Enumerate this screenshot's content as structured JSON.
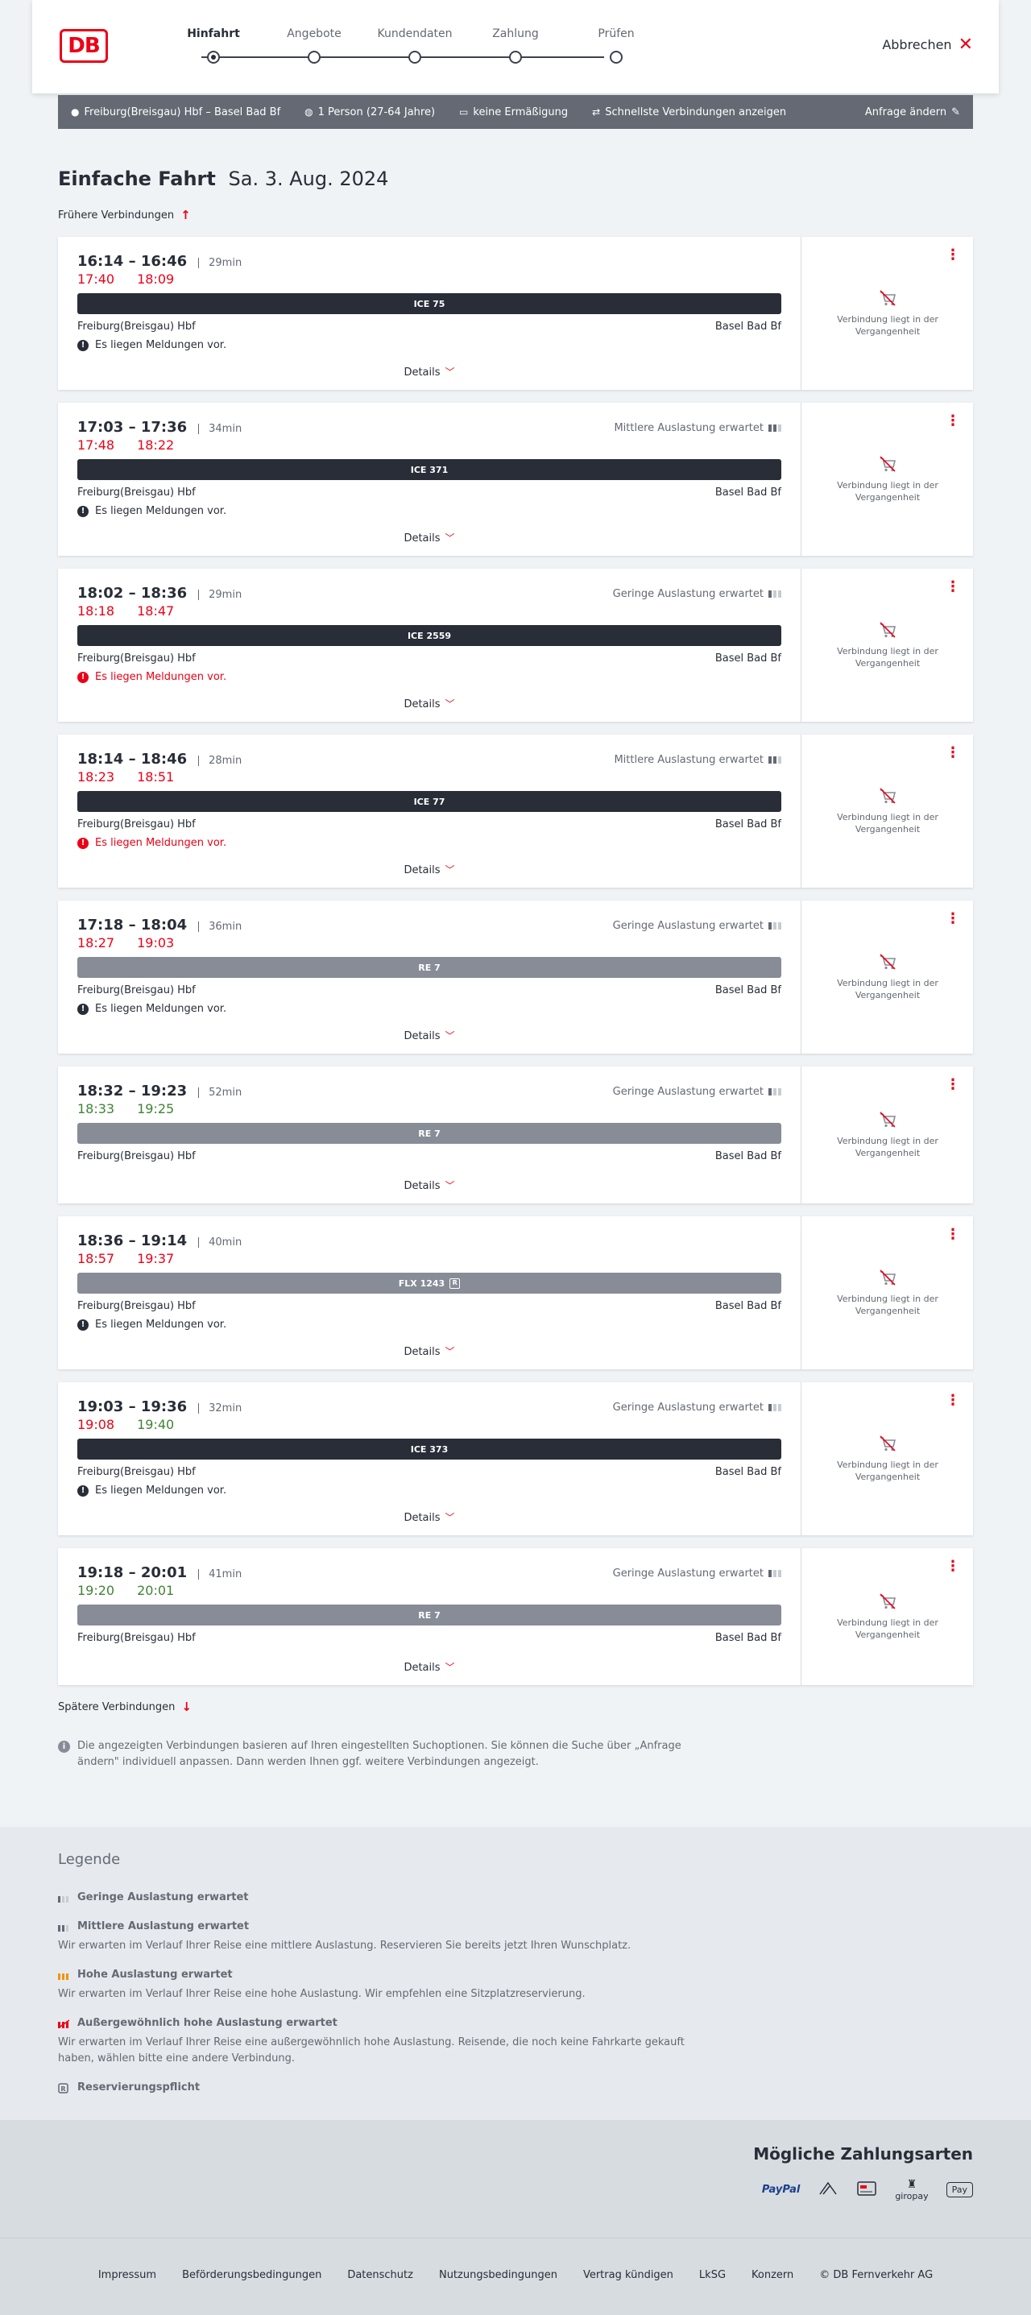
{
  "header": {
    "logo": "DB",
    "steps": [
      {
        "label": "Hinfahrt",
        "active": true
      },
      {
        "label": "Angebote",
        "active": false
      },
      {
        "label": "Kundendaten",
        "active": false
      },
      {
        "label": "Zahlung",
        "active": false
      },
      {
        "label": "Prüfen",
        "active": false
      }
    ],
    "cancel_label": "Abbrechen"
  },
  "query": {
    "route": "Freiburg(Breisgau) Hbf – Basel Bad Bf",
    "persons": "1 Person (27-64 Jahre)",
    "discount": "keine Ermäßigung",
    "option": "Schnellste Verbindungen anzeigen",
    "change_label": "Anfrage ändern"
  },
  "title": {
    "main": "Einfache Fahrt",
    "date": "Sa. 3. Aug. 2024"
  },
  "earlier_label": "Frühere Verbindungen",
  "later_label": "Spätere Verbindungen",
  "details_label": "Details",
  "past_text_1": "Verbindung liegt in der",
  "past_text_2": "Vergangenheit",
  "connections": [
    {
      "times": "16:14 – 16:46",
      "duration": "29min",
      "occupancy": "",
      "rt_dep": "17:40",
      "rt_dep_status": "late",
      "rt_arr": "18:09",
      "rt_arr_status": "late",
      "train": "ICE 75",
      "style": "dark",
      "from": "Freiburg(Breisgau) Hbf",
      "to": "Basel Bad Bf",
      "message": "Es liegen Meldungen vor.",
      "message_style": "normal"
    },
    {
      "times": "17:03 – 17:36",
      "duration": "34min",
      "occupancy": "Mittlere Auslastung erwartet",
      "rt_dep": "17:48",
      "rt_dep_status": "late",
      "rt_arr": "18:22",
      "rt_arr_status": "late",
      "train": "ICE 371",
      "style": "dark",
      "from": "Freiburg(Breisgau) Hbf",
      "to": "Basel Bad Bf",
      "message": "Es liegen Meldungen vor.",
      "message_style": "normal"
    },
    {
      "times": "18:02 – 18:36",
      "duration": "29min",
      "occupancy": "Geringe Auslastung erwartet",
      "rt_dep": "18:18",
      "rt_dep_status": "late",
      "rt_arr": "18:47",
      "rt_arr_status": "late",
      "train": "ICE 2559",
      "style": "dark",
      "from": "Freiburg(Breisgau) Hbf",
      "to": "Basel Bad Bf",
      "message": "Es liegen Meldungen vor.",
      "message_style": "red"
    },
    {
      "times": "18:14 – 18:46",
      "duration": "28min",
      "occupancy": "Mittlere Auslastung erwartet",
      "rt_dep": "18:23",
      "rt_dep_status": "late",
      "rt_arr": "18:51",
      "rt_arr_status": "late",
      "train": "ICE 77",
      "style": "dark",
      "from": "Freiburg(Breisgau) Hbf",
      "to": "Basel Bad Bf",
      "message": "Es liegen Meldungen vor.",
      "message_style": "red"
    },
    {
      "times": "17:18 – 18:04",
      "duration": "36min",
      "occupancy": "Geringe Auslastung erwartet",
      "rt_dep": "18:27",
      "rt_dep_status": "late",
      "rt_arr": "19:03",
      "rt_arr_status": "late",
      "train": "RE 7",
      "style": "grey",
      "from": "Freiburg(Breisgau) Hbf",
      "to": "Basel Bad Bf",
      "message": "Es liegen Meldungen vor.",
      "message_style": "normal"
    },
    {
      "times": "18:32 – 19:23",
      "duration": "52min",
      "occupancy": "Geringe Auslastung erwartet",
      "rt_dep": "18:33",
      "rt_dep_status": "ok",
      "rt_arr": "19:25",
      "rt_arr_status": "ok",
      "train": "RE 7",
      "style": "grey",
      "from": "Freiburg(Breisgau) Hbf",
      "to": "Basel Bad Bf",
      "message": "",
      "message_style": "none"
    },
    {
      "times": "18:36 – 19:14",
      "duration": "40min",
      "occupancy": "",
      "rt_dep": "18:57",
      "rt_dep_status": "late",
      "rt_arr": "19:37",
      "rt_arr_status": "late",
      "train": "FLX 1243",
      "style": "grey",
      "reservation": true,
      "from": "Freiburg(Breisgau) Hbf",
      "to": "Basel Bad Bf",
      "message": "Es liegen Meldungen vor.",
      "message_style": "normal"
    },
    {
      "times": "19:03 – 19:36",
      "duration": "32min",
      "occupancy": "Geringe Auslastung erwartet",
      "rt_dep": "19:08",
      "rt_dep_status": "late",
      "rt_arr": "19:40",
      "rt_arr_status": "ok",
      "train": "ICE 373",
      "style": "dark",
      "from": "Freiburg(Breisgau) Hbf",
      "to": "Basel Bad Bf",
      "message": "Es liegen Meldungen vor.",
      "message_style": "normal"
    },
    {
      "times": "19:18 – 20:01",
      "duration": "41min",
      "occupancy": "Geringe Auslastung erwartet",
      "rt_dep": "19:20",
      "rt_dep_status": "ok",
      "rt_arr": "20:01",
      "rt_arr_status": "ok",
      "train": "RE 7",
      "style": "grey",
      "from": "Freiburg(Breisgau) Hbf",
      "to": "Basel Bad Bf",
      "message": "",
      "message_style": "none"
    }
  ],
  "note": "Die angezeigten Verbindungen basieren auf Ihren eingestellten Suchoptionen. Sie können die Suche über „Anfrage ändern\" individuell anpassen. Dann werden Ihnen ggf. weitere Verbindungen angezeigt.",
  "legend": {
    "title": "Legende",
    "items": [
      {
        "label": "Geringe Auslastung erwartet",
        "text": "",
        "icon": "occupancy-low-icon"
      },
      {
        "label": "Mittlere Auslastung erwartet",
        "text": "Wir erwarten im Verlauf Ihrer Reise eine mittlere Auslastung. Reservieren Sie bereits jetzt Ihren Wunschplatz.",
        "icon": "occupancy-medium-icon"
      },
      {
        "label": "Hohe Auslastung erwartet",
        "text": "Wir erwarten im Verlauf Ihrer Reise eine hohe Auslastung. Wir empfehlen eine Sitzplatzreservierung.",
        "icon": "occupancy-high-icon"
      },
      {
        "label": "Außergewöhnlich hohe Auslastung erwartet",
        "text": "Wir erwarten im Verlauf Ihrer Reise eine außergewöhnlich hohe Auslastung. Reisende, die noch keine Fahrkarte gekauft haben, wählen bitte eine andere Verbindung.",
        "icon": "occupancy-extreme-icon"
      },
      {
        "label": "Reservierungspflicht",
        "text": "",
        "icon": "reservation-required-icon"
      }
    ]
  },
  "payments": {
    "title": "Mögliche Zahlungsarten",
    "methods": [
      "PayPal",
      "Lastschrift",
      "Kreditkarte",
      "giropay",
      "Apple Pay"
    ],
    "giropay_label": "giropay",
    "paypal_label": "PayPal",
    "applepay_label": "Pay"
  },
  "footer": {
    "links": [
      "Impressum",
      "Beförderungsbedingungen",
      "Datenschutz",
      "Nutzungsbedingungen",
      "Vertrag kündigen",
      "LkSG",
      "Konzern",
      "© DB Fernverkehr AG"
    ]
  },
  "colors": {
    "accent": "#ec0016",
    "late": "#ec0016",
    "on_time": "#408335",
    "dark_train": "#282d37",
    "grey_train": "#878c96"
  }
}
